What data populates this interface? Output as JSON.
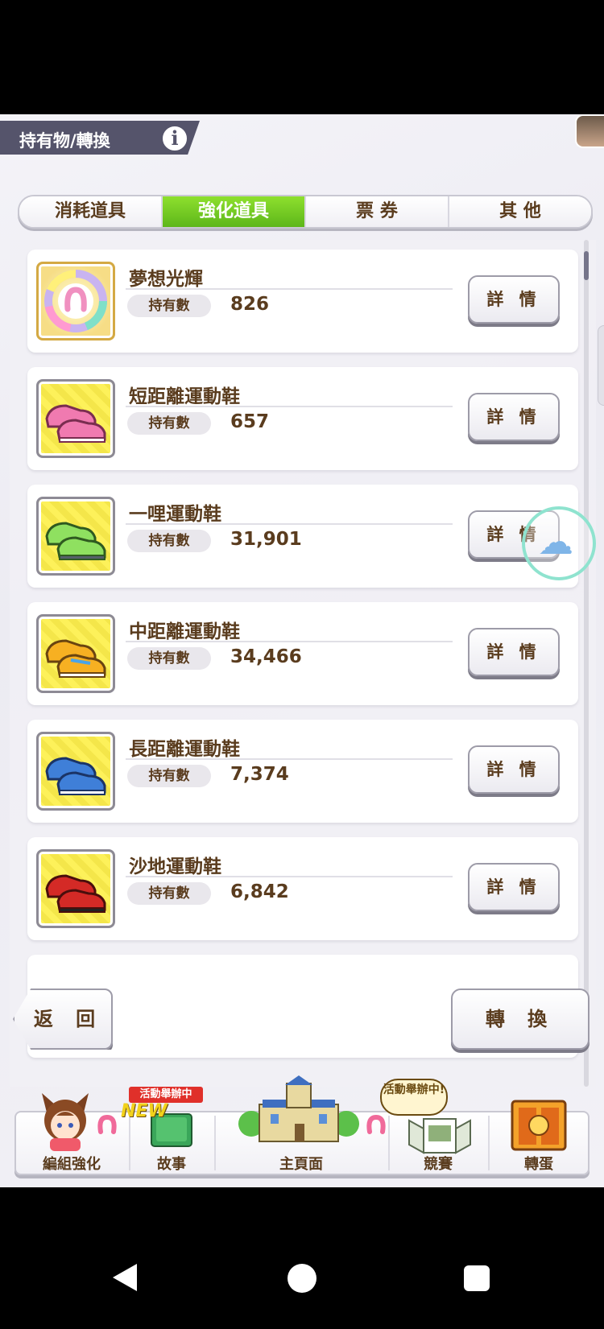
{
  "header": {
    "title": "持有物/轉換",
    "info_icon": "i"
  },
  "tabs": [
    {
      "label": "消耗道具",
      "active": false
    },
    {
      "label": "強化道具",
      "active": true
    },
    {
      "label": "票  券",
      "active": false
    },
    {
      "label": "其  他",
      "active": false
    }
  ],
  "items": [
    {
      "name": "夢想光輝",
      "own_label": "持有數",
      "count": "826",
      "detail_label": "詳 情",
      "icon": "rainbow-horseshoe-icon"
    },
    {
      "name": "短距離運動鞋",
      "own_label": "持有數",
      "count": "657",
      "detail_label": "詳 情",
      "icon": "pink-shoes-icon"
    },
    {
      "name": "一哩運動鞋",
      "own_label": "持有數",
      "count": "31,901",
      "detail_label": "詳 情",
      "icon": "green-shoes-icon"
    },
    {
      "name": "中距離運動鞋",
      "own_label": "持有數",
      "count": "34,466",
      "detail_label": "詳 情",
      "icon": "yellow-shoes-icon"
    },
    {
      "name": "長距離運動鞋",
      "own_label": "持有數",
      "count": "7,374",
      "detail_label": "詳 情",
      "icon": "blue-shoes-icon"
    },
    {
      "name": "沙地運動鞋",
      "own_label": "持有數",
      "count": "6,842",
      "detail_label": "詳 情",
      "icon": "red-shoes-icon"
    }
  ],
  "actions": {
    "back_label": "返 回",
    "convert_label": "轉 換"
  },
  "bottom_nav": [
    {
      "label": "編組強化",
      "icon": "horse-girl-avatar-icon"
    },
    {
      "label": "故事",
      "badge": "活動舉辦中",
      "new_badge": "NEW",
      "icon": "story-book-icon"
    },
    {
      "label": "主頁面",
      "icon": "school-building-icon"
    },
    {
      "label": "競賽",
      "badge": "活動舉辦中!",
      "icon": "race-icon"
    },
    {
      "label": "轉蛋",
      "icon": "gacha-gate-icon"
    }
  ],
  "colors": {
    "tab_active": "#6cc61f",
    "text_brown": "#5a3c1e",
    "header_bg": "#55546b"
  }
}
